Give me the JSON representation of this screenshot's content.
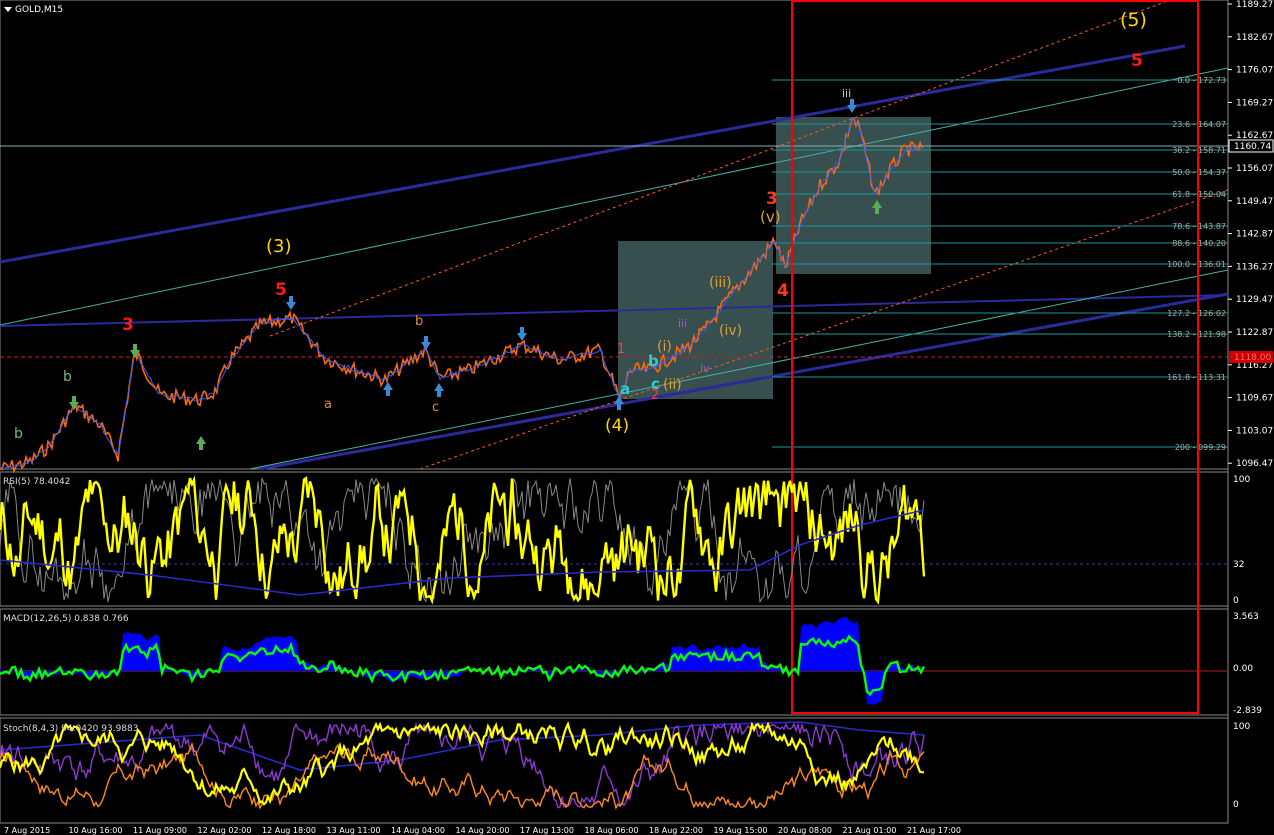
{
  "window": {
    "symbol_title": "GOLD,M15"
  },
  "price_axis": {
    "ticks": [
      "1189.27",
      "1182.67",
      "1176.07",
      "1169.27",
      "1162.67",
      "1156.07",
      "1149.47",
      "1142.87",
      "1136.27",
      "1129.47",
      "1122.87",
      "1116.27",
      "1109.67",
      "1103.07",
      "1096.47"
    ],
    "current_price": "1160.74",
    "marker_price": "1118.00"
  },
  "fib_levels": [
    {
      "label": "0.0 - 172.73"
    },
    {
      "label": "23.6 - 164.07"
    },
    {
      "label": "38.2 - 158.71"
    },
    {
      "label": "50.0 - 154.37"
    },
    {
      "label": "61.8 - 150.04"
    },
    {
      "label": "78.6 - 143.87"
    },
    {
      "label": "88.6 - 140.20"
    },
    {
      "label": "100.0 - 136.01"
    },
    {
      "label": "127.2 - 126.02"
    },
    {
      "label": "138.2 - 121.98"
    },
    {
      "label": "161.8 - 113.31"
    },
    {
      "label": "200 - 099.29"
    }
  ],
  "wave_labels": {
    "w5_big": "(5)",
    "w5_red": "5",
    "w3_big": "(3)",
    "w5_red_left": "5",
    "w3_red_left": "3",
    "b_green": "b",
    "b_green2": "b",
    "a_orange": "a",
    "b_orange": "b",
    "c_orange": "c",
    "w4_big": "(4)",
    "a_cyan": "a",
    "b_cyan": "b",
    "c_cyan": "c",
    "w1_small": "1",
    "w2_small": "2",
    "i_orange": "(i)",
    "ii_orange": "(ii)",
    "iii_orange": "(iii)",
    "iv_orange": "(iv)",
    "v_orange": "(v)",
    "iii_purple": "iii",
    "iv_purple": "iv",
    "w3_red_mid": "3",
    "w4_red_mid": "4",
    "iii_small": "iii"
  },
  "rsi": {
    "title": "RSI(5) 78.4042",
    "ticks": [
      "100",
      "32",
      "0"
    ]
  },
  "macd": {
    "title": "MACD(12,26,5) 0.838 0.766",
    "ticks": [
      "3.563",
      "0.00",
      "-2.839"
    ]
  },
  "stoch": {
    "title": "Stoch(8,4,3) 94.0420 93.9883",
    "ticks": [
      "100",
      "0"
    ]
  },
  "time_axis": [
    "7 Aug 2015",
    "10 Aug 16:00",
    "11 Aug 09:00",
    "12 Aug 02:00",
    "12 Aug 18:00",
    "13 Aug 11:00",
    "14 Aug 04:00",
    "14 Aug 20:00",
    "17 Aug 13:00",
    "18 Aug 06:00",
    "18 Aug 22:00",
    "19 Aug 15:00",
    "20 Aug 08:00",
    "21 Aug 01:00",
    "21 Aug 17:00"
  ],
  "colors": {
    "background": "#000000",
    "price_line": "#ff6a00",
    "rsi_line": "#ffff00",
    "macd_hist": "#0000ff",
    "macd_line": "#00ff00",
    "trend_line": "#2a2a9a",
    "highlight_box": "#ff0000",
    "fib_line": "#1a9a9a"
  }
}
